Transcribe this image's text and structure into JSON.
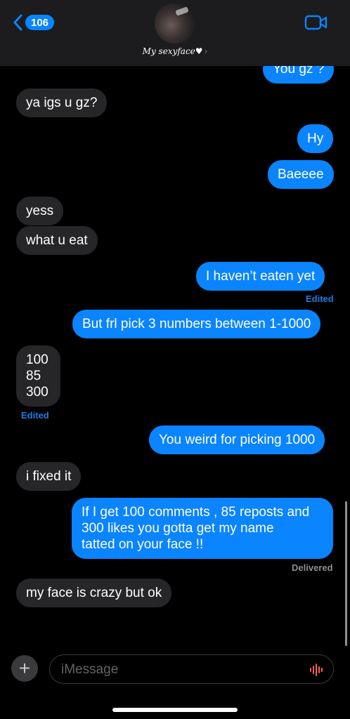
{
  "header": {
    "back_count": "106",
    "contact_name": "My sexyface♥",
    "chevron": "›"
  },
  "messages": [
    {
      "text": "You gz ?",
      "dir": "out"
    },
    {
      "text": "ya igs u gz?",
      "dir": "in"
    },
    {
      "text": "Hy",
      "dir": "out"
    },
    {
      "text": "Baeeee",
      "dir": "out"
    },
    {
      "text": "yess",
      "dir": "in"
    },
    {
      "text": "what u eat",
      "dir": "in"
    },
    {
      "text": "I haven’t eaten yet",
      "dir": "out",
      "status": "Edited"
    },
    {
      "text": "But frl pick 3 numbers between 1-1000",
      "dir": "out"
    },
    {
      "lines": [
        "100",
        "85",
        "300"
      ],
      "dir": "in",
      "status": "Edited"
    },
    {
      "text": "You weird for picking 1000",
      "dir": "out"
    },
    {
      "text": "i fixed it",
      "dir": "in"
    },
    {
      "lines": [
        "If I get 100 comments , 85 reposts and",
        "300 likes you gotta get my name",
        "tatted on your face !!"
      ],
      "dir": "out",
      "status": "Delivered"
    },
    {
      "text": "my face is crazy but ok",
      "dir": "in"
    }
  ],
  "composer": {
    "plus": "+",
    "placeholder": "iMessage"
  },
  "colors": {
    "outgoing": "#0a84ff",
    "incoming": "#262629",
    "background": "#000000",
    "edited_label": "#1e7be0"
  },
  "icons": [
    "back-chevron-icon",
    "video-camera-icon",
    "plus-icon",
    "audio-waveform-icon"
  ]
}
